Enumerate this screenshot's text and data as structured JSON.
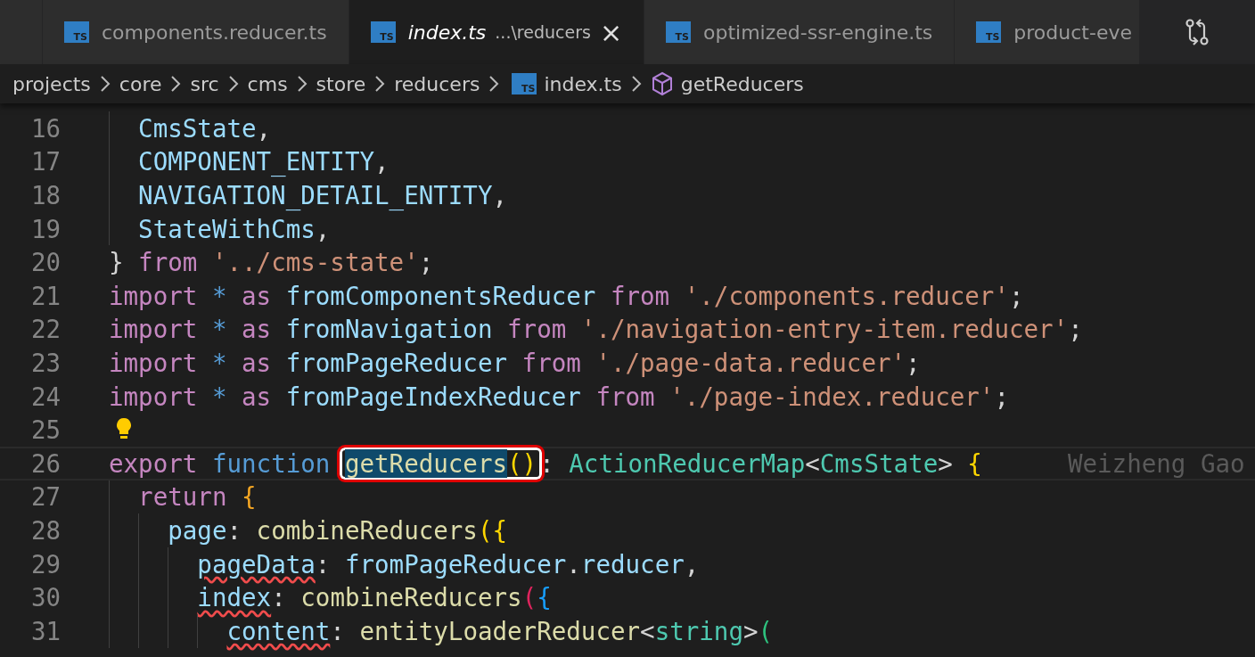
{
  "tabs": [
    {
      "icon": "TS",
      "name": "components.reducer.ts",
      "selected": false,
      "preview": false
    },
    {
      "icon": "TS",
      "name": "index.ts",
      "description": "...\\reducers",
      "selected": true,
      "preview": true,
      "close": "×"
    },
    {
      "icon": "TS",
      "name": "optimized-ssr-engine.ts",
      "selected": false,
      "preview": false
    },
    {
      "icon": "TS",
      "name": "product-eve",
      "selected": false,
      "preview": false
    }
  ],
  "breadcrumbs": [
    {
      "kind": "folder",
      "label": "projects"
    },
    {
      "kind": "folder",
      "label": "core"
    },
    {
      "kind": "folder",
      "label": "src"
    },
    {
      "kind": "folder",
      "label": "cms"
    },
    {
      "kind": "folder",
      "label": "store"
    },
    {
      "kind": "folder",
      "label": "reducers"
    },
    {
      "kind": "file",
      "icon": "TS",
      "label": "index.ts"
    },
    {
      "kind": "symbol",
      "label": "getReducers"
    }
  ],
  "lines": [
    {
      "number": "16",
      "tokens": [
        {
          "text": "  CmsState",
          "kind": "var"
        },
        {
          "text": ",",
          "kind": "punc"
        }
      ]
    },
    {
      "number": "17",
      "tokens": [
        {
          "text": "  COMPONENT_ENTITY",
          "kind": "var"
        },
        {
          "text": ",",
          "kind": "punc"
        }
      ]
    },
    {
      "number": "18",
      "tokens": [
        {
          "text": "  NAVIGATION_DETAIL_ENTITY",
          "kind": "var"
        },
        {
          "text": ",",
          "kind": "punc"
        }
      ]
    },
    {
      "number": "19",
      "tokens": [
        {
          "text": "  StateWithCms",
          "kind": "var"
        },
        {
          "text": ",",
          "kind": "punc"
        }
      ]
    },
    {
      "number": "20",
      "tokens": [
        {
          "text": "}",
          "kind": "punc"
        },
        {
          "text": " from ",
          "kind": "kw"
        },
        {
          "text": "'../cms-state'",
          "kind": "str"
        },
        {
          "text": ";",
          "kind": "punc"
        }
      ]
    },
    {
      "number": "21",
      "tokens": [
        {
          "text": "import",
          "kind": "kw"
        },
        {
          "text": " * ",
          "kind": "kwb"
        },
        {
          "text": "as ",
          "kind": "kw"
        },
        {
          "text": "fromComponentsReducer",
          "kind": "var"
        },
        {
          "text": " from ",
          "kind": "kw"
        },
        {
          "text": "'./components.reducer'",
          "kind": "str"
        },
        {
          "text": ";",
          "kind": "punc"
        }
      ]
    },
    {
      "number": "22",
      "tokens": [
        {
          "text": "import",
          "kind": "kw"
        },
        {
          "text": " * ",
          "kind": "kwb"
        },
        {
          "text": "as ",
          "kind": "kw"
        },
        {
          "text": "fromNavigation",
          "kind": "var"
        },
        {
          "text": " from ",
          "kind": "kw"
        },
        {
          "text": "'./navigation-entry-item.reducer'",
          "kind": "str"
        },
        {
          "text": ";",
          "kind": "punc"
        }
      ]
    },
    {
      "number": "23",
      "tokens": [
        {
          "text": "import",
          "kind": "kw"
        },
        {
          "text": " * ",
          "kind": "kwb"
        },
        {
          "text": "as ",
          "kind": "kw"
        },
        {
          "text": "fromPageReducer",
          "kind": "var"
        },
        {
          "text": " from ",
          "kind": "kw"
        },
        {
          "text": "'./page-data.reducer'",
          "kind": "str"
        },
        {
          "text": ";",
          "kind": "punc"
        }
      ]
    },
    {
      "number": "24",
      "tokens": [
        {
          "text": "import",
          "kind": "kw"
        },
        {
          "text": " * ",
          "kind": "kwb"
        },
        {
          "text": "as ",
          "kind": "kw"
        },
        {
          "text": "fromPageIndexReducer",
          "kind": "var"
        },
        {
          "text": " from ",
          "kind": "kw"
        },
        {
          "text": "'./page-index.reducer'",
          "kind": "str"
        },
        {
          "text": ";",
          "kind": "punc"
        }
      ]
    },
    {
      "number": "25",
      "lightbulb": true
    },
    {
      "number": "26",
      "current": true,
      "blame": "Weizheng Gao",
      "tokens": [
        {
          "text": "export",
          "kind": "kw"
        },
        {
          "text": " function ",
          "kind": "kwb"
        },
        {
          "kind": "boxed",
          "tokens": [
            {
              "text": "getReducers",
              "kind": "fn",
              "highlight": true
            },
            {
              "text": "()",
              "kind": "gold"
            }
          ]
        },
        {
          "text": ": ",
          "kind": "punc"
        },
        {
          "text": "ActionReducerMap",
          "kind": "type"
        },
        {
          "text": "<",
          "kind": "punc"
        },
        {
          "text": "CmsState",
          "kind": "type"
        },
        {
          "text": "> ",
          "kind": "punc"
        },
        {
          "text": "{",
          "kind": "gold"
        }
      ]
    },
    {
      "number": "27",
      "tokens": [
        {
          "text": "  return",
          "kind": "kw"
        },
        {
          "text": " {",
          "kind": "orange"
        }
      ]
    },
    {
      "number": "28",
      "tokens": [
        {
          "text": "    page",
          "kind": "var"
        },
        {
          "text": ": ",
          "kind": "punc"
        },
        {
          "text": "combineReducers",
          "kind": "fn"
        },
        {
          "text": "({",
          "kind": "gold"
        }
      ]
    },
    {
      "number": "29",
      "tokens": [
        {
          "text": "      pageData",
          "kind": "var",
          "squiggle": true
        },
        {
          "text": ": ",
          "kind": "punc"
        },
        {
          "text": "fromPageReducer",
          "kind": "var"
        },
        {
          "text": ".",
          "kind": "punc"
        },
        {
          "text": "reducer",
          "kind": "var"
        },
        {
          "text": ",",
          "kind": "punc"
        }
      ]
    },
    {
      "number": "30",
      "tokens": [
        {
          "text": "      index",
          "kind": "var",
          "squiggle": true
        },
        {
          "text": ": ",
          "kind": "punc"
        },
        {
          "text": "combineReducers",
          "kind": "fn"
        },
        {
          "text": "(",
          "kind": "crimson"
        },
        {
          "text": "{",
          "kind": "blue"
        }
      ]
    },
    {
      "number": "31",
      "tokens": [
        {
          "text": "        content",
          "kind": "var",
          "squiggle": true
        },
        {
          "text": ": ",
          "kind": "punc"
        },
        {
          "text": "entityLoaderReducer",
          "kind": "fn"
        },
        {
          "text": "<",
          "kind": "punc"
        },
        {
          "text": "string",
          "kind": "type"
        },
        {
          "text": ">",
          "kind": "punc"
        },
        {
          "text": "(",
          "kind": "green"
        }
      ]
    }
  ]
}
